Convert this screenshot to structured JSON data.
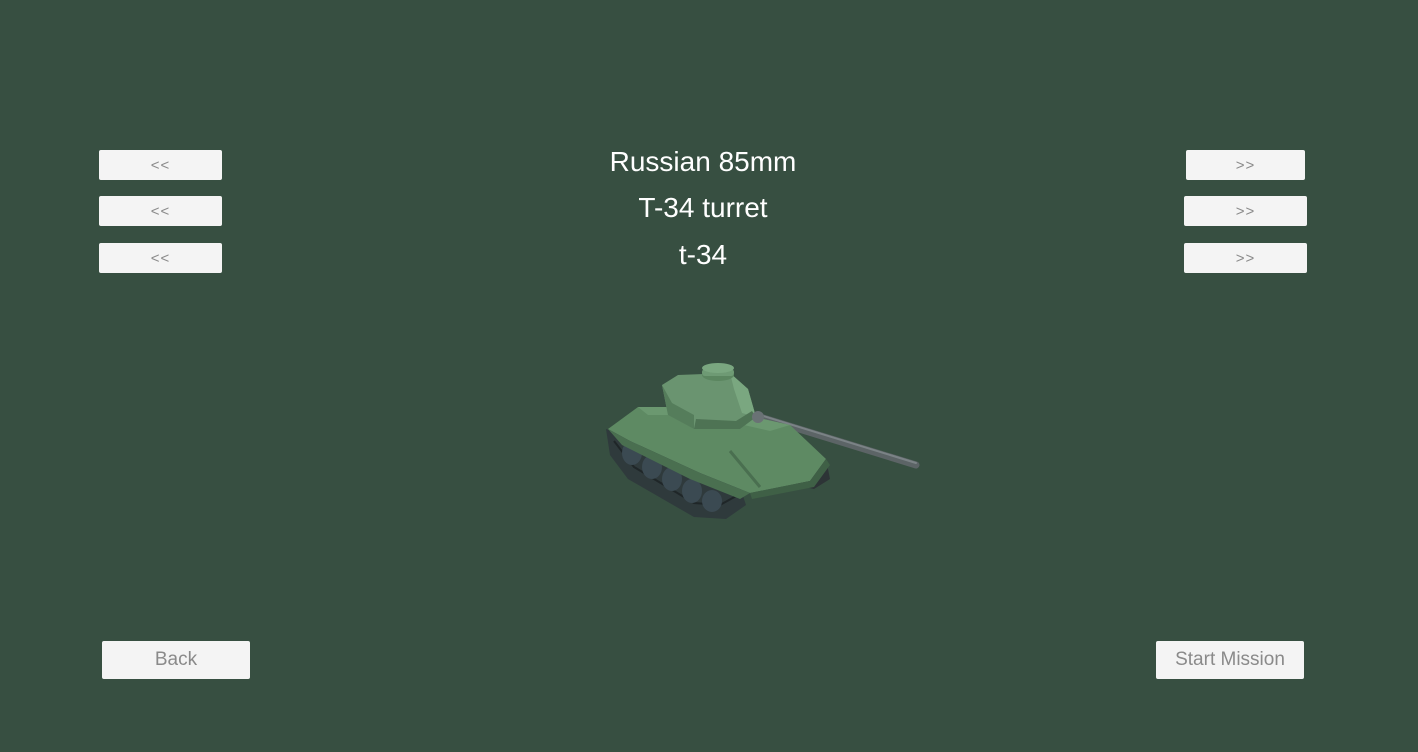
{
  "selectors": {
    "row1": {
      "label": "Russian 85mm",
      "prev": "<<",
      "next": ">>"
    },
    "row2": {
      "label": "T-34 turret",
      "prev": "<<",
      "next": ">>"
    },
    "row3": {
      "label": "t-34",
      "prev": "<<",
      "next": ">>"
    }
  },
  "footer": {
    "back_label": "Back",
    "start_label": "Start Mission"
  },
  "colors": {
    "background": "#374f41",
    "button_bg": "#f4f4f4",
    "button_text": "#8a8a8a",
    "label_text": "#ffffff",
    "tank_body": "#5e8a63"
  },
  "preview": {
    "model": "tank-model"
  }
}
